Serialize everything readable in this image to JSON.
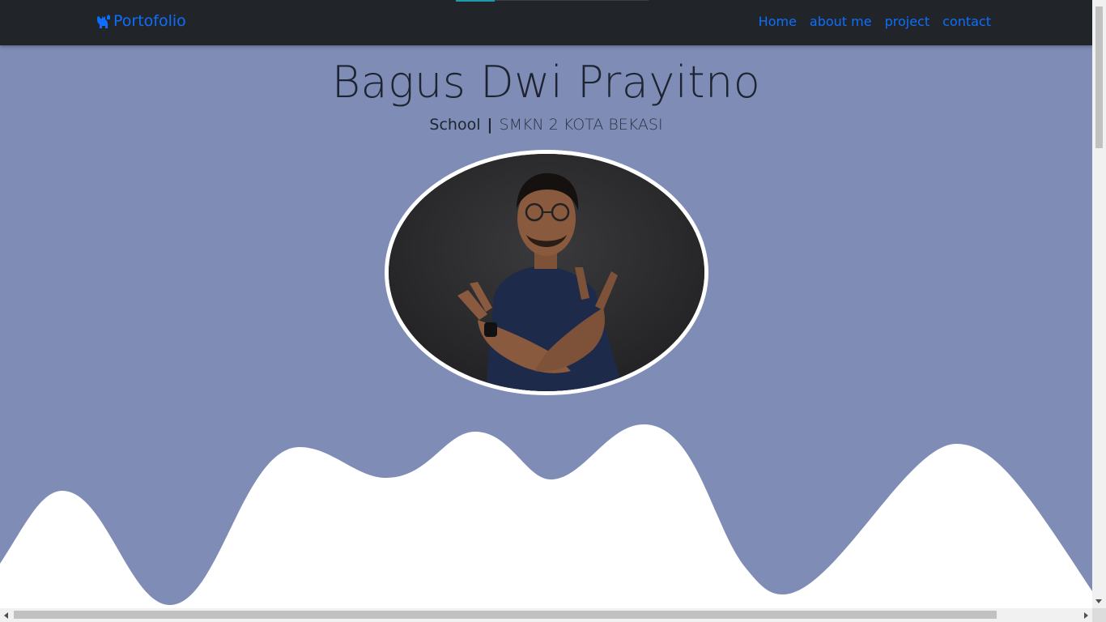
{
  "navbar": {
    "brand_icon": "cat-icon",
    "brand_label": "Portofolio",
    "links": [
      "Home",
      "about me",
      "project",
      "contact"
    ]
  },
  "hero": {
    "title": "Bagus Dwi Prayitno",
    "subtitle_label": "School",
    "subtitle_separator": "|",
    "subtitle_value": "SMKN 2 KOTA BEKASI",
    "avatar_alt_icon": "profile-photo"
  },
  "colors": {
    "navbar_bg": "#212529",
    "link": "#0d6efd",
    "hero_bg": "#7f8cb6",
    "wave_fill": "#ffffff",
    "title_text": "#1d2431"
  }
}
